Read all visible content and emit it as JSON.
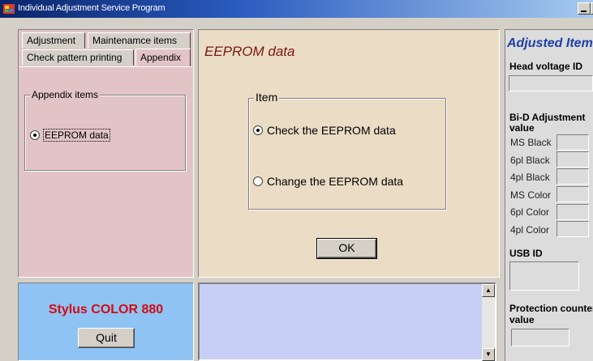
{
  "window": {
    "title": "Individual Adjustment Service Program"
  },
  "tabs": [
    {
      "label": "Adjustment"
    },
    {
      "label": "Maintenamce items"
    },
    {
      "label": "Check pattern printing"
    },
    {
      "label": "Appendix"
    }
  ],
  "left_panel": {
    "group_title": "Appendix items",
    "radio_label": "EEPROM data"
  },
  "center_panel": {
    "title": "EEPROM data",
    "group_title": "Item",
    "options": [
      {
        "label": "Check the EEPROM data",
        "selected": true
      },
      {
        "label": "Change the EEPROM data",
        "selected": false
      }
    ],
    "ok_label": "OK"
  },
  "bottom_left": {
    "model_name": "Stylus COLOR 880",
    "quit_label": "Quit"
  },
  "right_panel": {
    "title": "Adjusted Item",
    "head_voltage_label": "Head voltage ID",
    "bid_label_1": "Bi-D Adjustment",
    "bid_label_2": "value",
    "bid_rows": [
      "MS Black",
      "6pl Black",
      "4pl Black",
      "MS Color",
      "6pl Color",
      "4pl Color"
    ],
    "usb_label": "USB ID",
    "protection_label_1": "Protection counter",
    "protection_label_2": "value"
  }
}
